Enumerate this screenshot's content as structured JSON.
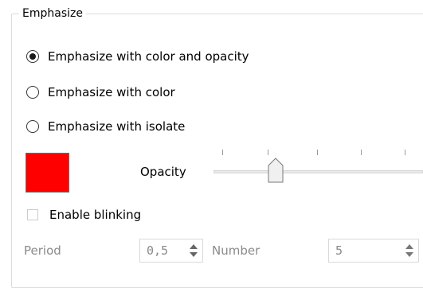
{
  "group": {
    "title": "Emphasize"
  },
  "radio_options": [
    {
      "label": "Emphasize with color and opacity",
      "checked": true
    },
    {
      "label": "Emphasize with color",
      "checked": false
    },
    {
      "label": "Emphasize with isolate",
      "checked": false
    }
  ],
  "color": {
    "value": "#ff0000"
  },
  "opacity": {
    "label": "Opacity",
    "level_fraction": 0.28
  },
  "blinking": {
    "label": "Enable blinking",
    "checked": false
  },
  "period": {
    "label": "Period",
    "value": "0,5"
  },
  "number": {
    "label": "Number",
    "value": "5"
  },
  "icons": [
    "radio-checked-icon",
    "radio-unchecked-icon",
    "spin-up-icon",
    "spin-down-icon",
    "slider-thumb-icon"
  ]
}
